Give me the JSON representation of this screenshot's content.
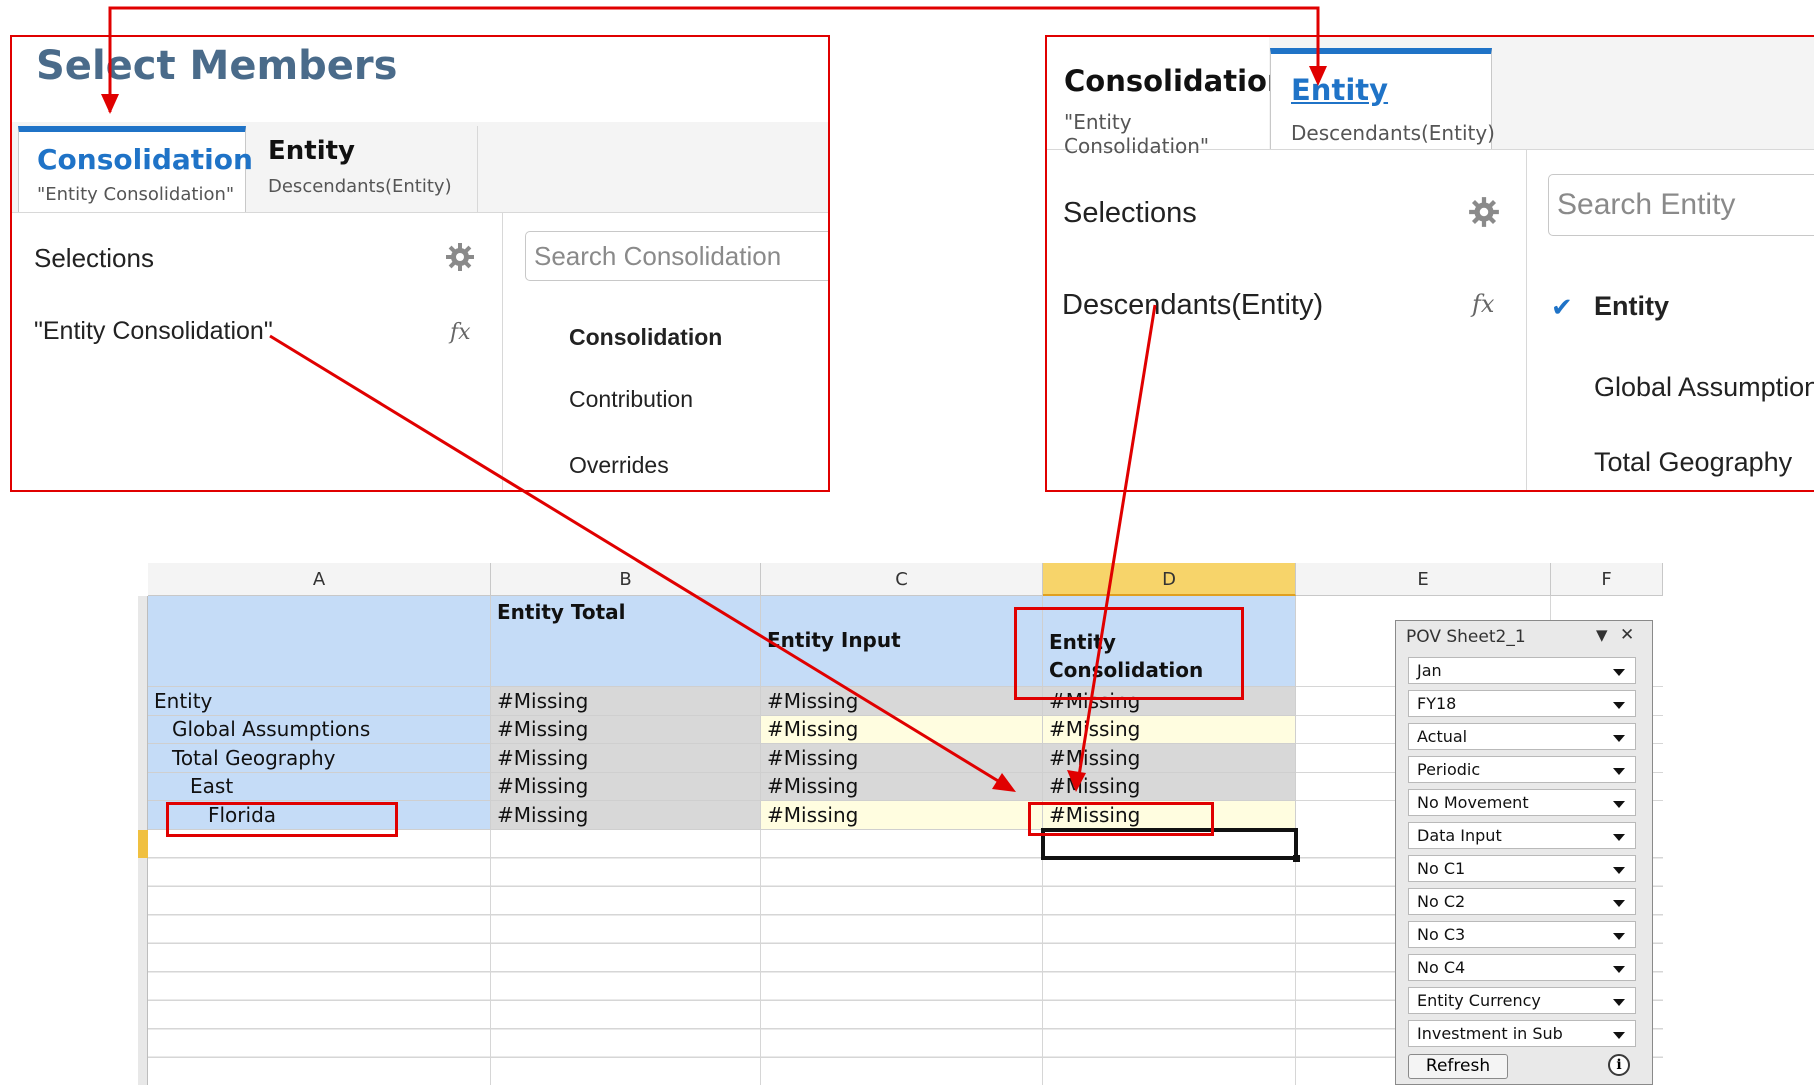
{
  "left_panel": {
    "title": "Select Members",
    "tab_active": {
      "title": "Consolidation",
      "sub": "\"Entity Consolidation\""
    },
    "tab_inactive": {
      "title": "Entity",
      "sub": "Descendants(Entity)"
    },
    "selections_label": "Selections",
    "selection_value": "\"Entity Consolidation\"",
    "fx": "fx",
    "search_placeholder": "Search Consolidation",
    "members": [
      "Consolidation",
      "Contribution",
      "Overrides"
    ]
  },
  "right_panel": {
    "tab_inactive": {
      "title": "Consolidation",
      "sub": "\"Entity Consolidation\""
    },
    "tab_active": {
      "title": "Entity",
      "sub": "Descendants(Entity)"
    },
    "selections_label": "Selections",
    "selection_value": "Descendants(Entity)",
    "fx": "fx",
    "search_placeholder": "Search Entity",
    "checkmark": "✔",
    "members": [
      "Entity",
      "Global Assumptions",
      "Total Geography"
    ]
  },
  "sheet": {
    "columns": [
      "A",
      "B",
      "C",
      "D",
      "E",
      "F"
    ],
    "header": {
      "b": "Entity Total",
      "c": "Entity Input",
      "d1": "Entity",
      "d2": "Consolidation"
    },
    "rows": [
      {
        "a": "Entity",
        "b": "#Missing",
        "c": "#Missing",
        "d": "#Missing"
      },
      {
        "a": "Global Assumptions",
        "b": "#Missing",
        "c": "#Missing",
        "d": "#Missing"
      },
      {
        "a": "Total Geography",
        "b": "#Missing",
        "c": "#Missing",
        "d": "#Missing"
      },
      {
        "a": "East",
        "b": "#Missing",
        "c": "#Missing",
        "d": "#Missing"
      },
      {
        "a": "Florida",
        "b": "#Missing",
        "c": "#Missing",
        "d": "#Missing"
      }
    ]
  },
  "pov": {
    "title": "POV Sheet2_1",
    "menu_glyph": "▼",
    "close_glyph": "✕",
    "items": [
      "Jan",
      "FY18",
      "Actual",
      "Periodic",
      "No Movement",
      "Data Input",
      "No C1",
      "No C2",
      "No C3",
      "No C4",
      "Entity Currency",
      "Investment in Sub"
    ],
    "refresh": "Refresh",
    "info": "i"
  },
  "colors": {
    "annotation": "#e00000",
    "tab_accent": "#1f73c7",
    "header_blue": "#c5dcf7"
  }
}
